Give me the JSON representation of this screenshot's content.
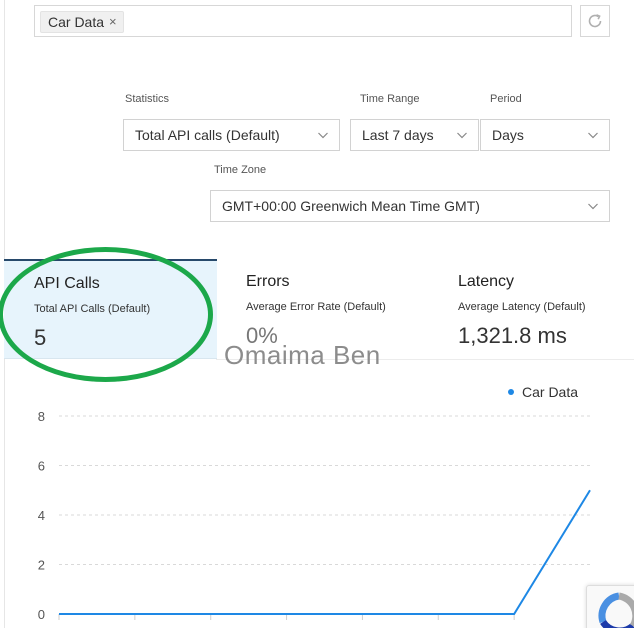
{
  "filter": {
    "chip_label": "Car Data",
    "chip_remove": "×"
  },
  "statistics": {
    "label": "Statistics",
    "value": "Total API calls (Default)"
  },
  "time_range": {
    "label": "Time Range",
    "value": "Last 7 days"
  },
  "period": {
    "label": "Period",
    "value": "Days"
  },
  "time_zone": {
    "label": "Time Zone",
    "value": "GMT+00:00 Greenwich Mean Time GMT)"
  },
  "tiles": [
    {
      "title": "API Calls",
      "subtitle": "Total API Calls (Default)",
      "value": "5"
    },
    {
      "title": "Errors",
      "subtitle": "Average Error Rate (Default)",
      "value": "0%"
    },
    {
      "title": "Latency",
      "subtitle": "Average Latency (Default)",
      "value": "1,321.8 ms"
    }
  ],
  "annotation": {
    "watermark": "Omaima Ben",
    "highlight_color": "#1ca84a"
  },
  "colors": {
    "series": "#1e88e5",
    "active_tile": "#e7f4fc",
    "active_tile_border": "#27496b"
  },
  "icons": {
    "refresh": "refresh-icon",
    "dropdown": "chevron-down-icon",
    "recaptcha": "recaptcha-icon"
  },
  "chart_data": {
    "type": "line",
    "series": [
      {
        "name": "Car Data",
        "values": [
          0,
          0,
          0,
          0,
          0,
          0,
          0,
          5
        ]
      }
    ],
    "ylim": [
      0,
      8
    ],
    "yticks": [
      0,
      2,
      4,
      6,
      8
    ],
    "grid": true,
    "legend": "top-right",
    "title": "",
    "xlabel": "",
    "ylabel": ""
  }
}
